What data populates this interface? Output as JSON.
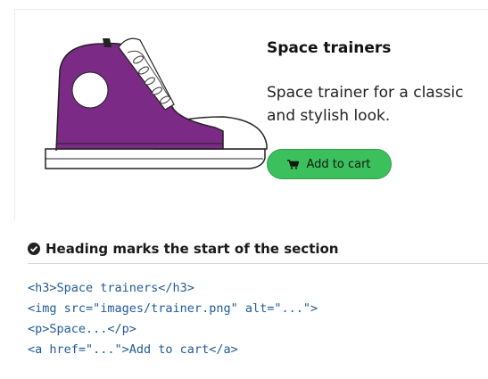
{
  "product": {
    "title": "Space trainers",
    "description": "Space trainer for a classic and stylish look.",
    "cta_label": "Add to cart",
    "image_icon": "sneaker-illustration",
    "cart_icon": "cart-icon"
  },
  "check": {
    "icon": "check-circle-icon",
    "heading": "Heading marks the start of the section"
  },
  "code_lines": [
    "<h3>Space trainers</h3>",
    "<img src=\"images/trainer.png\" alt=\"...\">",
    "<p>Space...</p>",
    "<a href=\"...\">Add to cart</a>"
  ],
  "colors": {
    "button": "#3cc05d",
    "shoe_upper": "#7b2a86",
    "code_text": "#1f5a96"
  }
}
